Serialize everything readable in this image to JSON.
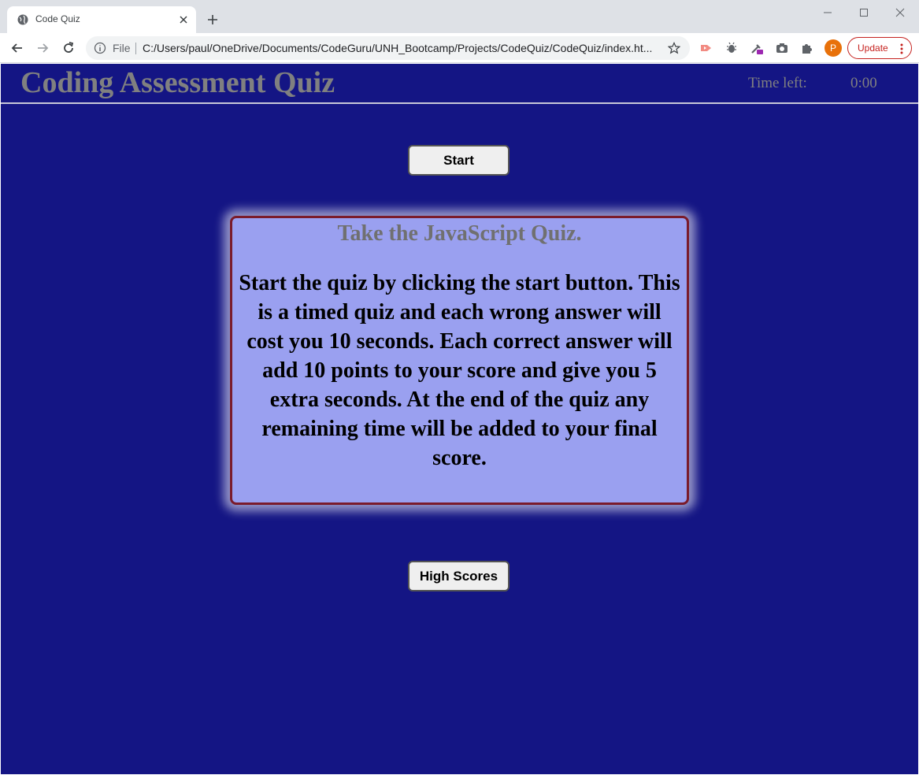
{
  "browser": {
    "tab_title": "Code Quiz",
    "omnibox_scheme": "File",
    "url": "C:/Users/paul/OneDrive/Documents/CodeGuru/UNH_Bootcamp/Projects/CodeQuiz/CodeQuiz/index.ht...",
    "profile_initial": "P",
    "update_label": "Update"
  },
  "header": {
    "title": "Coding Assessment Quiz",
    "time_label": "Time left:",
    "time_value": "0:00"
  },
  "buttons": {
    "start": "Start",
    "high_scores": "High Scores"
  },
  "card": {
    "title": "Take the JavaScript Quiz.",
    "body": "Start the quiz by clicking the start button. This is a timed quiz and each wrong answer will cost you 10 seconds. Each correct answer will add 10 points to your score and give you 5 extra seconds. At the end of the quiz any remaining time will be added to your final score."
  },
  "colors": {
    "page_bg": "#141584",
    "card_bg": "#9aa0f0",
    "card_border": "#7a1b2b",
    "header_text": "#808080"
  }
}
